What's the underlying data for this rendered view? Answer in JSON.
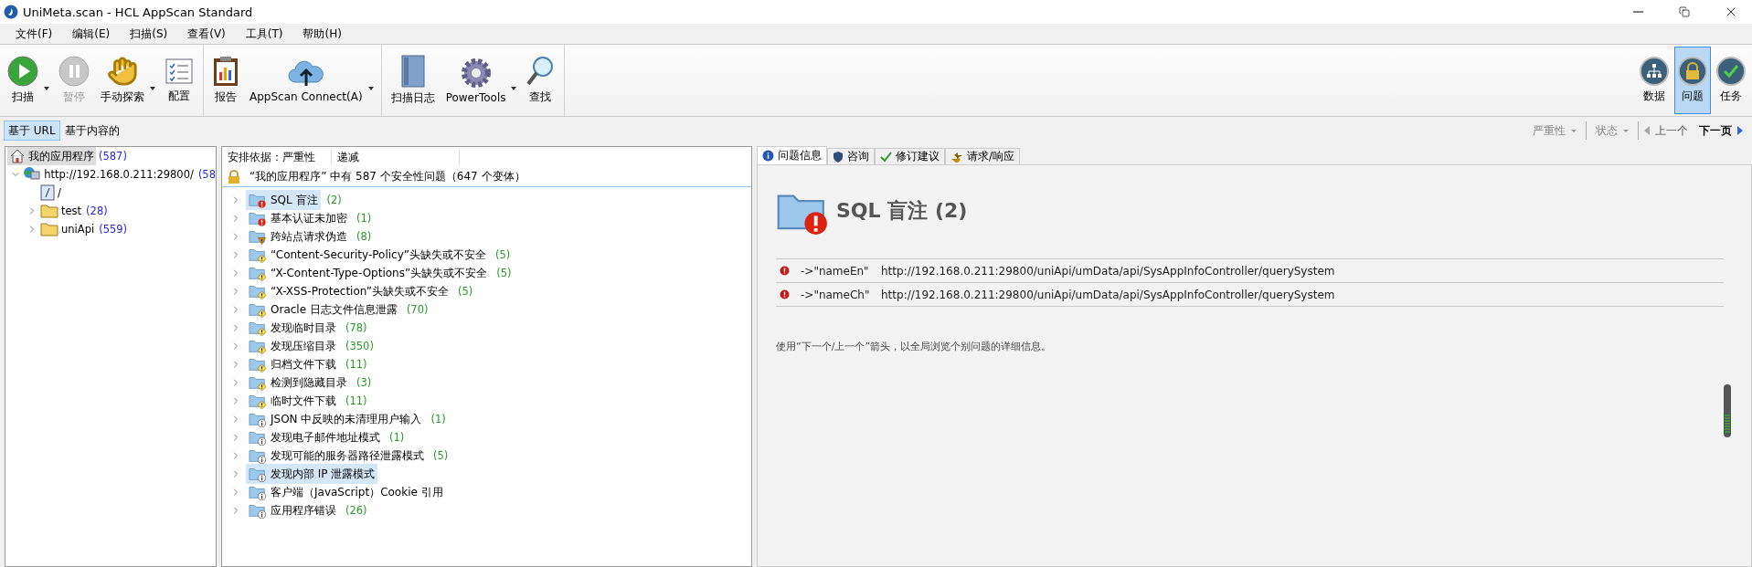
{
  "window": {
    "title": "UniMeta.scan - HCL AppScan Standard"
  },
  "menu": [
    "文件(F)",
    "编辑(E)",
    "扫描(S)",
    "查看(V)",
    "工具(T)",
    "帮助(H)"
  ],
  "toolbar": [
    [
      {
        "label": "扫描",
        "disabled": false,
        "dropdown": true
      },
      {
        "label": "暂停",
        "disabled": true,
        "dropdown": false
      },
      {
        "label": "手动探索",
        "disabled": false,
        "dropdown": true
      },
      {
        "label": "配置",
        "disabled": false,
        "dropdown": false
      }
    ],
    [
      {
        "label": "报告",
        "disabled": false,
        "dropdown": false
      },
      {
        "label": "AppScan Connect(A)",
        "disabled": false,
        "dropdown": true
      }
    ],
    [
      {
        "label": "扫描日志",
        "disabled": false,
        "dropdown": false
      },
      {
        "label": "PowerTools",
        "disabled": false,
        "dropdown": true
      },
      {
        "label": "查找",
        "disabled": false,
        "dropdown": false
      }
    ]
  ],
  "views": [
    {
      "label": "数据",
      "selected": false
    },
    {
      "label": "问题",
      "selected": true
    },
    {
      "label": "任务",
      "selected": false
    }
  ],
  "view_tabs": [
    {
      "label": "基于 URL",
      "selected": true
    },
    {
      "label": "基于内容的",
      "selected": false
    }
  ],
  "filters": [
    {
      "label": "严重性"
    },
    {
      "label": "状态"
    }
  ],
  "nav": {
    "previous": "上一个",
    "next": "下一页"
  },
  "tree": [
    {
      "label": "我的应用程序",
      "count": "(587)",
      "kind": "home",
      "selected": true,
      "children": [
        {
          "label": "http://192.168.0.211:29800/",
          "count": "(58",
          "kind": "server",
          "selected": false,
          "expanded": true,
          "children": [
            {
              "label": "/",
              "kind": "page",
              "selected": false
            },
            {
              "label": "test",
              "count": "(28)",
              "kind": "folder",
              "selected": false,
              "expanded": false
            },
            {
              "label": "uniApi",
              "count": "(559)",
              "kind": "folder",
              "selected": false,
              "expanded": false
            }
          ]
        }
      ]
    }
  ],
  "issue_list": {
    "columns": [
      "安排依据：严重性",
      "递减"
    ],
    "summary": "“我的应用程序” 中有 587 个安全性问题（647 个变体）",
    "items": [
      {
        "label": "SQL 盲注",
        "count": "(2)",
        "kind": "high",
        "selected": true
      },
      {
        "label": "基本认证未加密",
        "count": "(1)",
        "kind": "high",
        "selected": false
      },
      {
        "label": "跨站点请求伪造",
        "count": "(8)",
        "kind": "medium",
        "selected": false
      },
      {
        "label": "“Content-Security-Policy”头缺失或不安全",
        "count": "(5)",
        "kind": "low",
        "selected": false
      },
      {
        "label": "“X-Content-Type-Options”头缺失或不安全",
        "count": "(5)",
        "kind": "low",
        "selected": false
      },
      {
        "label": "“X-XSS-Protection”头缺失或不安全",
        "count": "(5)",
        "kind": "low",
        "selected": false
      },
      {
        "label": "Oracle 日志文件信息泄露",
        "count": "(70)",
        "kind": "low",
        "selected": false
      },
      {
        "label": "发现临时目录",
        "count": "(78)",
        "kind": "low",
        "selected": false
      },
      {
        "label": "发现压缩目录",
        "count": "(350)",
        "kind": "low",
        "selected": false
      },
      {
        "label": "归档文件下载",
        "count": "(11)",
        "kind": "low",
        "selected": false
      },
      {
        "label": "检测到隐藏目录",
        "count": "(3)",
        "kind": "low",
        "selected": false
      },
      {
        "label": "临时文件下载",
        "count": "(11)",
        "kind": "low",
        "selected": false
      },
      {
        "label": "JSON 中反映的未清理用户输入",
        "count": "(1)",
        "kind": "info",
        "selected": false
      },
      {
        "label": "发现电子邮件地址模式",
        "count": "(1)",
        "kind": "info",
        "selected": false
      },
      {
        "label": "发现可能的服务器路径泄露模式",
        "count": "(5)",
        "kind": "info",
        "selected": false
      },
      {
        "label": "发现内部 IP 泄露模式",
        "kind": "info",
        "selected": true
      },
      {
        "label": "客户端（JavaScript）Cookie 引用",
        "kind": "info",
        "selected": false
      },
      {
        "label": "应用程序错误",
        "count": "(26)",
        "kind": "info",
        "selected": false
      }
    ]
  },
  "detail_tabs": [
    {
      "label": "问题信息",
      "selected": true
    },
    {
      "label": "咨询",
      "selected": false
    },
    {
      "label": "修订建议",
      "selected": false
    },
    {
      "label": "请求/响应",
      "selected": false
    }
  ],
  "detail": {
    "title": "SQL 盲注 (2)",
    "items": [
      {
        "param": "->\"nameEn\"",
        "url": "http://192.168.0.211:29800/uniApi/umData/api/SysAppInfoController/querySystem"
      },
      {
        "param": "->\"nameCh\"",
        "url": "http://192.168.0.211:29800/uniApi/umData/api/SysAppInfoController/querySystem"
      }
    ],
    "hint": "使用“下一个/上一个”箭头，以全局浏览个别问题的详细信息。"
  }
}
